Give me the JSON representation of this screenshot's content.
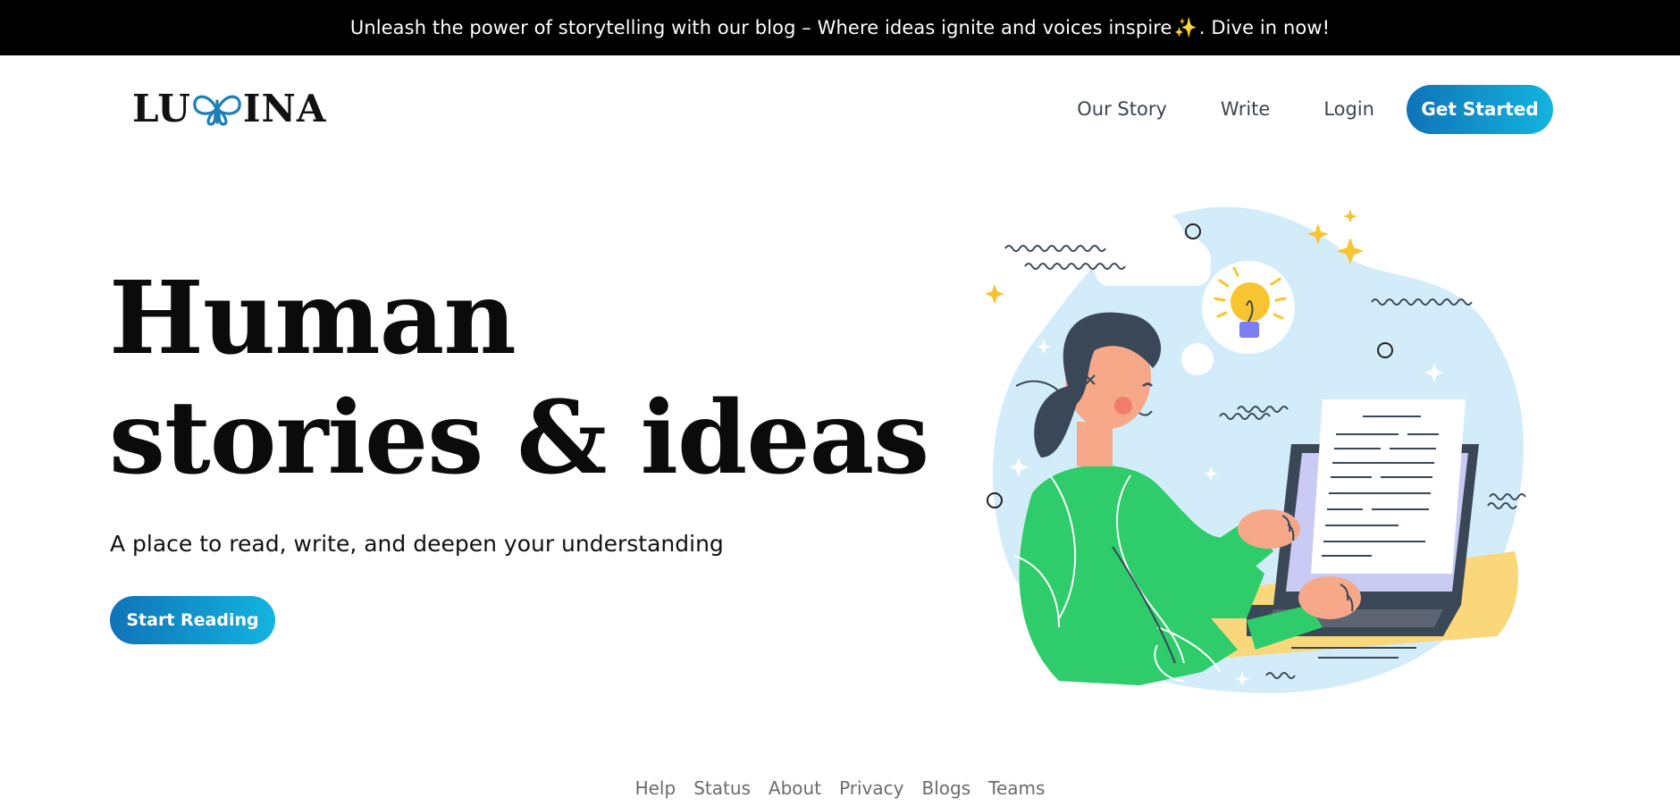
{
  "announcement": {
    "text": "Unleash the power of storytelling with our blog – Where ideas ignite and voices inspire",
    "sparkle": "✨",
    "suffix": ". Dive in now!"
  },
  "brand": {
    "left": "LU",
    "right": "INA",
    "logo_mark_icon": "butterfly-icon",
    "logo_mark_color": "#1c7fb5"
  },
  "nav": {
    "links": [
      "Our Story",
      "Write",
      "Login"
    ],
    "cta": "Get Started"
  },
  "hero": {
    "title_line1": "Human",
    "title_line2": "stories & ideas",
    "subtitle": "A place to read, write, and deepen your understanding",
    "cta": "Start Reading"
  },
  "footer": {
    "links": [
      "Help",
      "Status",
      "About",
      "Privacy",
      "Blogs",
      "Teams"
    ]
  },
  "colors": {
    "accent_start": "#0f73b7",
    "accent_end": "#13b4e0",
    "illustration_bg": "#d3ecfa",
    "shirt": "#2ecc6a",
    "desk": "#f9d77a",
    "skin": "#f6a889",
    "hair": "#3a4757"
  }
}
